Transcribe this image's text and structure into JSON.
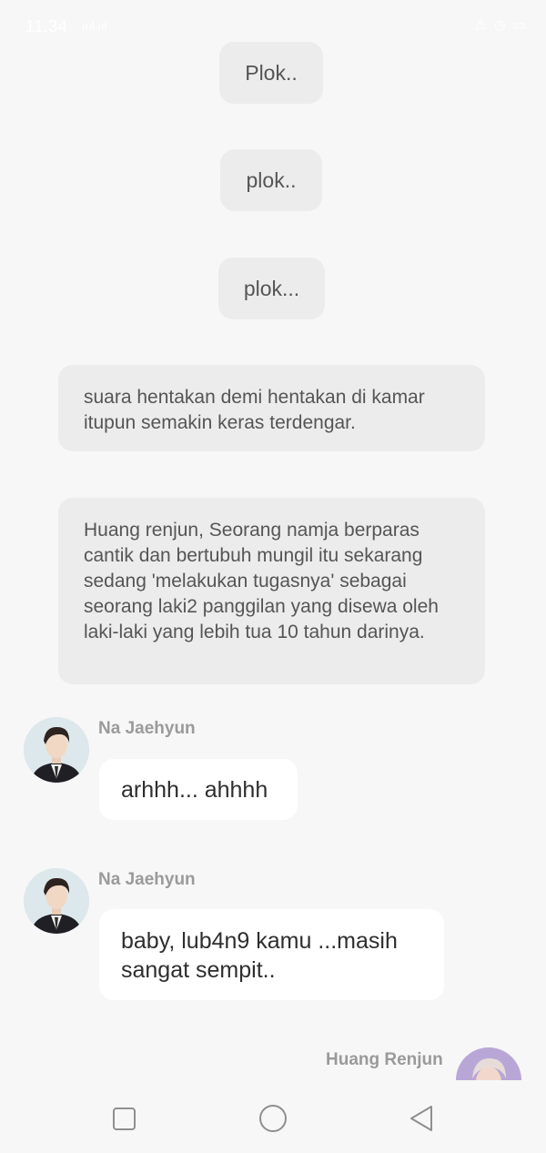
{
  "status_bar": {
    "time": "11.34",
    "signal": "ıııl ııl",
    "icons": [
      "alarm-icon",
      "clock-icon",
      "battery-icon"
    ]
  },
  "narration": [
    {
      "text": "Plok.."
    },
    {
      "text": "plok.."
    },
    {
      "text": "plok..."
    },
    {
      "text": "suara hentakan demi hentakan di kamar itupun semakin  keras terdengar."
    },
    {
      "text": "Huang renjun, Seorang namja berparas cantik dan bertubuh mungil itu sekarang sedang 'melakukan tugasnya' sebagai seorang laki2 panggilan yang disewa oleh laki-laki yang lebih tua 10 tahun darinya."
    }
  ],
  "messages": [
    {
      "sender": "Na Jaehyun",
      "text": "arhhh... ahhhh"
    },
    {
      "sender": "Na Jaehyun",
      "text": "baby, lub4n9 kamu ...masih sangat sempit.."
    }
  ],
  "next_sender": "Huang Renjun",
  "nav": {
    "recents": "square-icon",
    "home": "circle-icon",
    "back": "triangle-back-icon"
  }
}
